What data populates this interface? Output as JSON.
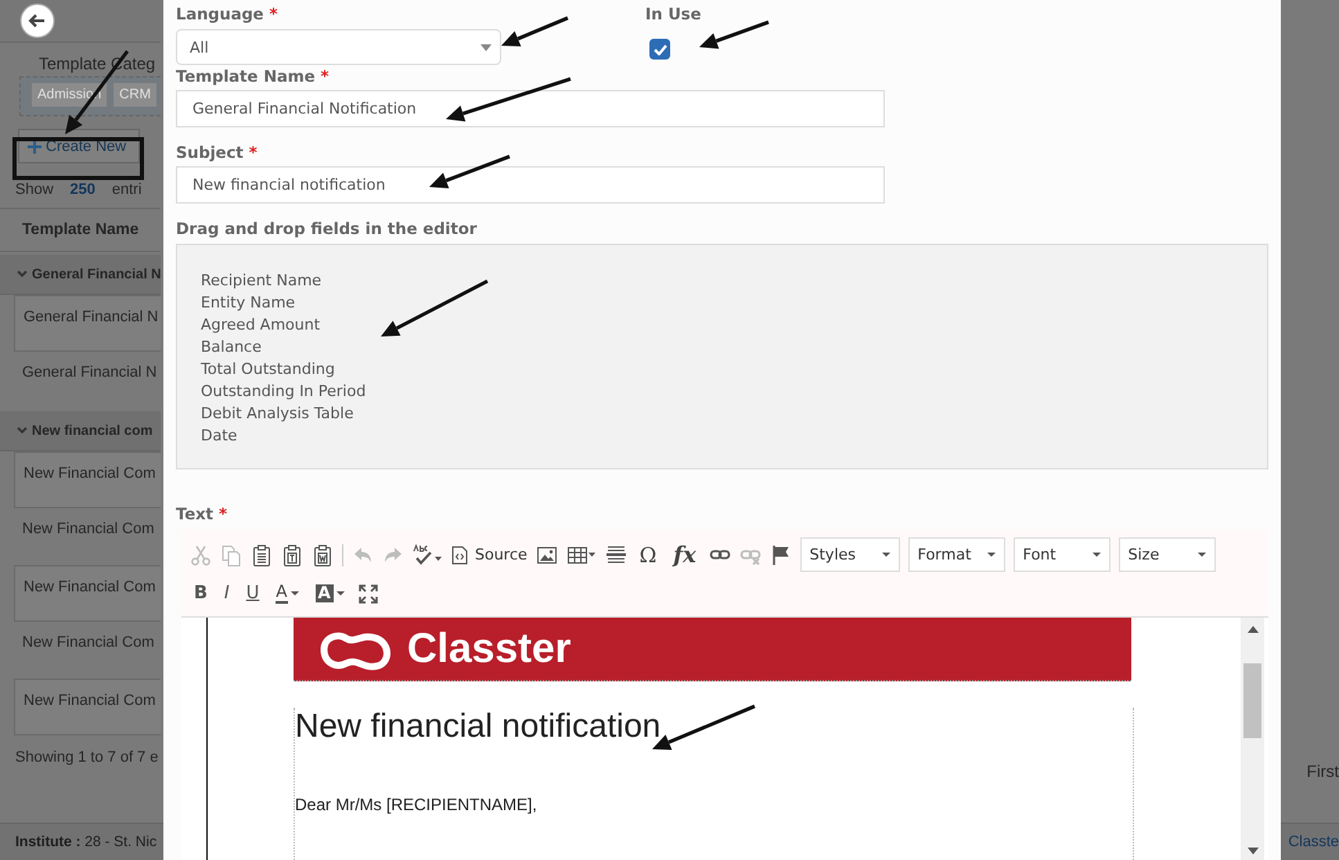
{
  "background": {
    "category_label": "Template Categ",
    "tags": [
      "Admission",
      "CRM"
    ],
    "create_button": "Create New",
    "show": {
      "label": "Show",
      "value": "250",
      "suffix": "entri"
    },
    "table": {
      "column": "Template Name",
      "groups": [
        {
          "label": "General Financial N",
          "expanded": true,
          "rows": [
            "General Financial N",
            "General Financial N"
          ]
        },
        {
          "label": "New financial com",
          "expanded": true,
          "rows": [
            "New Financial Com",
            "New Financial Com",
            "New Financial Com",
            "New Financial Com",
            "New Financial Com"
          ]
        }
      ]
    },
    "summary": "Showing 1 to 7 of 7 e",
    "pager": "First",
    "footer": {
      "label": "Institute :",
      "value": "28 - St. Nic",
      "link": "Classte"
    }
  },
  "modal": {
    "language": {
      "label": "Language",
      "required_mark": "*",
      "value": "All"
    },
    "in_use": {
      "label": "In Use",
      "checked": true
    },
    "template_name": {
      "label": "Template Name",
      "required_mark": "*",
      "value": "General Financial Notification"
    },
    "subject": {
      "label": "Subject",
      "required_mark": "*",
      "value": "New financial notification"
    },
    "fields_label": "Drag and drop fields in the editor",
    "fields": [
      "Recipient Name",
      "Entity Name",
      "Agreed Amount",
      "Balance",
      "Total Outstanding",
      "Outstanding In Period",
      "Debit Analysis Table",
      "Date"
    ],
    "text_label": {
      "label": "Text",
      "required_mark": "*"
    },
    "toolbar": [
      [
        {
          "kind": "cut",
          "disabled": true
        },
        {
          "kind": "copy",
          "disabled": true
        },
        {
          "kind": "paste",
          "disabled": false
        },
        {
          "kind": "paste-text",
          "disabled": false
        },
        {
          "kind": "paste-word",
          "disabled": false
        },
        {
          "kind": "separator"
        },
        {
          "kind": "undo",
          "disabled": true
        },
        {
          "kind": "redo",
          "disabled": true
        },
        {
          "kind": "spellcheck",
          "disabled": false
        },
        {
          "kind": "source",
          "label": "Source"
        },
        {
          "kind": "image",
          "disabled": false
        },
        {
          "kind": "table",
          "disabled": false
        },
        {
          "kind": "hline",
          "disabled": false
        },
        {
          "kind": "glyph",
          "label": "Ω"
        },
        {
          "kind": "formula",
          "label": "fx"
        },
        {
          "kind": "link",
          "disabled": false
        },
        {
          "kind": "unlink",
          "disabled": true
        },
        {
          "kind": "flag",
          "disabled": false
        },
        {
          "kind": "dropdown",
          "label": "Styles"
        },
        {
          "kind": "dropdown",
          "label": "Format"
        },
        {
          "kind": "dropdown",
          "label": "Font"
        },
        {
          "kind": "dropdown",
          "label": "Size"
        }
      ],
      [
        {
          "kind": "bold",
          "label": "B"
        },
        {
          "kind": "italic",
          "label": "I"
        },
        {
          "kind": "underline",
          "label": "U"
        },
        {
          "kind": "text-color",
          "label": "A"
        },
        {
          "kind": "bg-color",
          "label": "A"
        },
        {
          "kind": "maximize",
          "disabled": false
        }
      ]
    ],
    "document": {
      "logo": "Classter",
      "heading": "New financial notification",
      "greeting": "Dear Mr/Ms [RECIPIENTNAME],"
    }
  }
}
